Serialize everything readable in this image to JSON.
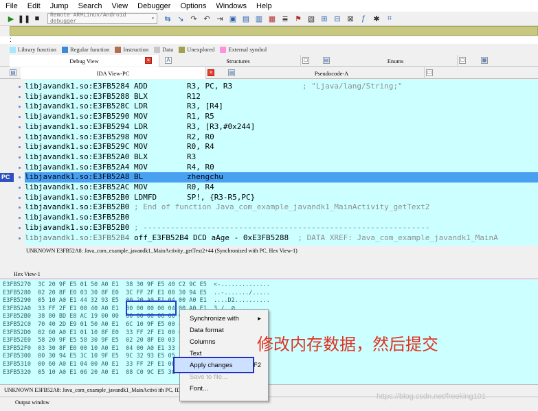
{
  "menu": [
    "File",
    "Edit",
    "Jump",
    "Search",
    "View",
    "Debugger",
    "Options",
    "Windows",
    "Help"
  ],
  "toolbar": {
    "debugger_select": "Remote ARMLinux/Android debugger"
  },
  "colon": ":",
  "legend": [
    {
      "label": "Library function",
      "color": "#a8e8ff"
    },
    {
      "label": "Regular function",
      "color": "#3a8ad8"
    },
    {
      "label": "Instruction",
      "color": "#b07050"
    },
    {
      "label": "Data",
      "color": "#c8c8c8"
    },
    {
      "label": "Unexplored",
      "color": "#a0a050"
    },
    {
      "label": "External symbol",
      "color": "#ff90e0"
    }
  ],
  "tabs_row1": {
    "debug_view": "Debug View",
    "structures": "Structures",
    "enums": "Enums"
  },
  "tabs_row2": {
    "ida_view": "IDA View-PC",
    "pseudocode": "Pseudocode-A"
  },
  "disasm": [
    {
      "addr": "libjavandk1.so:E3FB5284",
      "mn": "ADD",
      "op": "R3, PC, R3",
      "cm": "; \"Ljava/lang/String;\""
    },
    {
      "addr": "libjavandk1.so:E3FB5288",
      "mn": "BLX",
      "op": "R12",
      "cm": ""
    },
    {
      "addr": "libjavandk1.so:E3FB528C",
      "mn": "LDR",
      "op": "R3, [R4]",
      "cm": ""
    },
    {
      "addr": "libjavandk1.so:E3FB5290",
      "mn": "MOV",
      "op": "R1, R5",
      "cm": ""
    },
    {
      "addr": "libjavandk1.so:E3FB5294",
      "mn": "LDR",
      "op": "R3, [R3,#0x244]",
      "cm": ""
    },
    {
      "addr": "libjavandk1.so:E3FB5298",
      "mn": "MOV",
      "op": "R2, R0",
      "cm": ""
    },
    {
      "addr": "libjavandk1.so:E3FB529C",
      "mn": "MOV",
      "op": "R0, R4",
      "cm": ""
    },
    {
      "addr": "libjavandk1.so:E3FB52A0",
      "mn": "BLX",
      "op": "R3",
      "cm": ""
    },
    {
      "addr": "libjavandk1.so:E3FB52A4",
      "mn": "MOV",
      "op": "R4, R0",
      "cm": ""
    },
    {
      "addr": "libjavandk1.so:E3FB52A8",
      "mn": "BL",
      "op": "zhengchu",
      "cm": ""
    },
    {
      "addr": "libjavandk1.so:E3FB52AC",
      "mn": "MOV",
      "op": "R0, R4",
      "cm": ""
    },
    {
      "addr": "libjavandk1.so:E3FB52B0",
      "mn": "LDMFD",
      "op": "SP!, {R3-R5,PC}",
      "cm": ""
    },
    {
      "addr": "libjavandk1.so:E3FB52B0",
      "mn": "",
      "op": "",
      "cm": "; End of function Java_com_example_javandk1_MainActivity_getText2"
    },
    {
      "addr": "libjavandk1.so:E3FB52B0",
      "mn": "",
      "op": "",
      "cm": ""
    },
    {
      "addr": "libjavandk1.so:E3FB52B0",
      "mn": "",
      "op": "",
      "cm": "; ---------------------------------------------------------------"
    },
    {
      "addr": "libjavandk1.so:E3FB52B4",
      "mn": "off_E3FB52B4 DCD aAge - 0xE3FB5288",
      "op": "",
      "cm": "; DATA XREF: Java_com_example_javandk1_MainA"
    }
  ],
  "pc_label": "PC",
  "sync1": "UNKNOWN E3FB52A8: Java_com_example_javandk1_MainActivity_getText2+44 (Synchronized with PC, Hex View-1)",
  "hex_title": "Hex View-1",
  "hex_rows": [
    "E3FB5270  3C 20 9F E5 01 50 A0 E1  38 30 9F E5 40 C2 9C E5  <-..............",
    "E3FB5280  02 20 8F E0 03 30 8F E0  3C FF 2F E1 00 30 94 E5  ..-......./.....",
    "E3FB5290  05 10 A0 E1 44 32 93 E5  00 20 A0 E1 04 00 A0 E1  ....D2..........",
    "E3FB52A0  33 FF 2F E1 00 40 A0 E1  00 00 00 00 04 00 A0 E1  3./..@..........",
    "E3FB52B0  38 80 BD E8 AC 19 00 00  00 00 00 00 00 00 00 00  8...............",
    "E3FB52C0  70 40 2D E9 01 50 A0 E1  6C 10 9F E5 00 40 A0 E1  p@-..P..l....@..",
    "E3FB52D0  02 60 A0 E1 01 10 8F E0  33 FF 2F E1 00 00 50 E3  .`......3./...P.",
    "E3FB52E0  58 20 9F E5 58 30 9F E5  02 20 8F E0 03 30 8F E0  X...X0.......0..",
    "E3FB52F0  03 30 8F E0 00 10 A0 E1  04 00 A0 E1 33 FF 2F E1  .0..........3./.",
    "E3FB5300  00 30 94 E5 3C 10 9F E5  9C 32 93 E5 05 20 A0 E1  .0..<....2... ..",
    "E3FB5310  00 60 A0 E1 04 00 A0 E1  33 FF 2F E1 00 30 94 E5  .`......3./..0..",
    "E3FB5320  05 10 A0 E1 06 20 A0 E1  88 C0 9C E5 3C FF 2F E1  ..... ......<./."
  ],
  "context_menu": [
    {
      "label": "Synchronize with",
      "shortcut": "",
      "submenu": true,
      "disabled": false
    },
    {
      "label": "Data format",
      "shortcut": "",
      "submenu": false,
      "disabled": false
    },
    {
      "label": "Columns",
      "shortcut": "",
      "submenu": false,
      "disabled": false
    },
    {
      "label": "Text",
      "shortcut": "",
      "submenu": false,
      "disabled": false
    },
    {
      "label": "Apply changes",
      "shortcut": "F2",
      "submenu": false,
      "disabled": false
    },
    {
      "label": "Save to file...",
      "shortcut": "",
      "submenu": false,
      "disabled": true
    },
    {
      "label": "Font...",
      "shortcut": "",
      "submenu": false,
      "disabled": false
    }
  ],
  "annotation": "修改内存数据，然后提交",
  "sync2": "UNKNOWN E3FB52A8: Java_com_example_javandk1_MainActivi                                              ith PC, IDA View-PC)",
  "output_window": "Output window",
  "watermark": "https://blog.csdn.net/freeking101"
}
